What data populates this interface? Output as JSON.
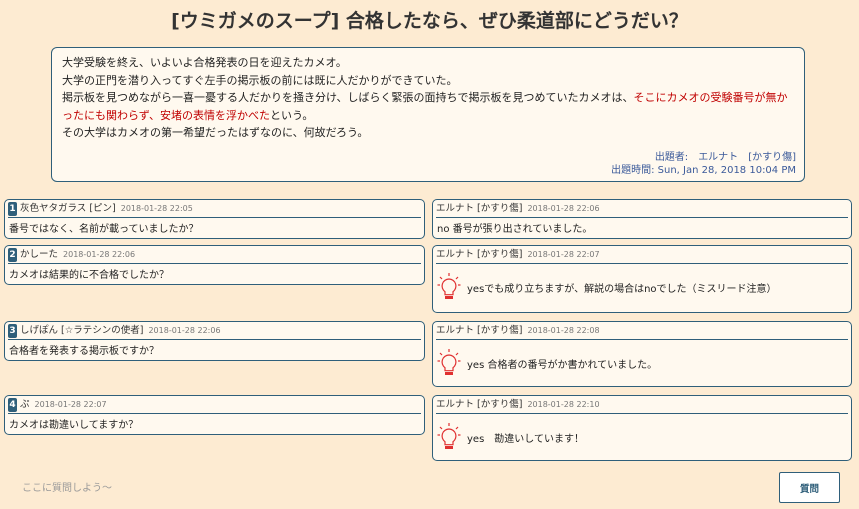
{
  "title": "[ウミガメのスープ] 合格したなら、ぜひ柔道部にどうだい？",
  "problem": {
    "line1": "大学受験を終え、いよいよ合格発表の日を迎えたカメオ。",
    "line2": "大学の正門を潜り入ってすぐ左手の掲示板の前には既に人だかりができていた。",
    "line3_plain": "掲示板を見つめながら一喜一憂する人だかりを掻き分け、しばらく緊張の面持ちで掲示板を見つめていたカメオは、",
    "line3_red": "そこにカメオの受験番号が無かったにも関わらず、安堵の表情を浮かべた",
    "line3_tail": "という。",
    "line4": "その大学はカメオの第一希望だったはずなのに、何故だろう。",
    "author_label": "出題者:",
    "author": "エルナト",
    "author_badge": "[かすり傷]",
    "time": "出題時間: Sun, Jan 28, 2018 10:04 PM"
  },
  "qa": [
    {
      "num": "1",
      "asker": "灰色ヤタガラス [ピン]",
      "qdate": "2018-01-28 22:05",
      "question": "番号ではなく、名前が載っていましたか？",
      "responder": "エルナト [かすり傷]",
      "adate": "2018-01-28 22:06",
      "answer": "no 番号が張り出されていました。",
      "good": false
    },
    {
      "num": "2",
      "asker": "かしーた",
      "qdate": "2018-01-28 22:06",
      "question": "カメオは結果的に不合格でしたか？",
      "responder": "エルナト [かすり傷]",
      "adate": "2018-01-28 22:07",
      "answer": "yesでも成り立ちますが、解説の場合はnoでした（ミスリード注意）",
      "good": true
    },
    {
      "num": "3",
      "asker": "しげぽん [☆ラテシンの使者]",
      "qdate": "2018-01-28 22:06",
      "question": "合格者を発表する掲示板ですか？",
      "responder": "エルナト [かすり傷]",
      "adate": "2018-01-28 22:08",
      "answer": "yes 合格者の番号がか書かれていました。",
      "good": true
    },
    {
      "num": "4",
      "asker": "ぷ",
      "qdate": "2018-01-28 22:07",
      "question": "カメオは勘違いしてますか？",
      "responder": "エルナト [かすり傷]",
      "adate": "2018-01-28 22:10",
      "answer": "yes　勘違いしています！",
      "good": true
    }
  ],
  "input": {
    "placeholder": "ここに質問しよう〜"
  },
  "submit_label": "質問",
  "colors": {
    "background": "#fdebd2",
    "border": "#2f5f7a",
    "highlight": "#c00000",
    "bulb": "#e03030"
  }
}
